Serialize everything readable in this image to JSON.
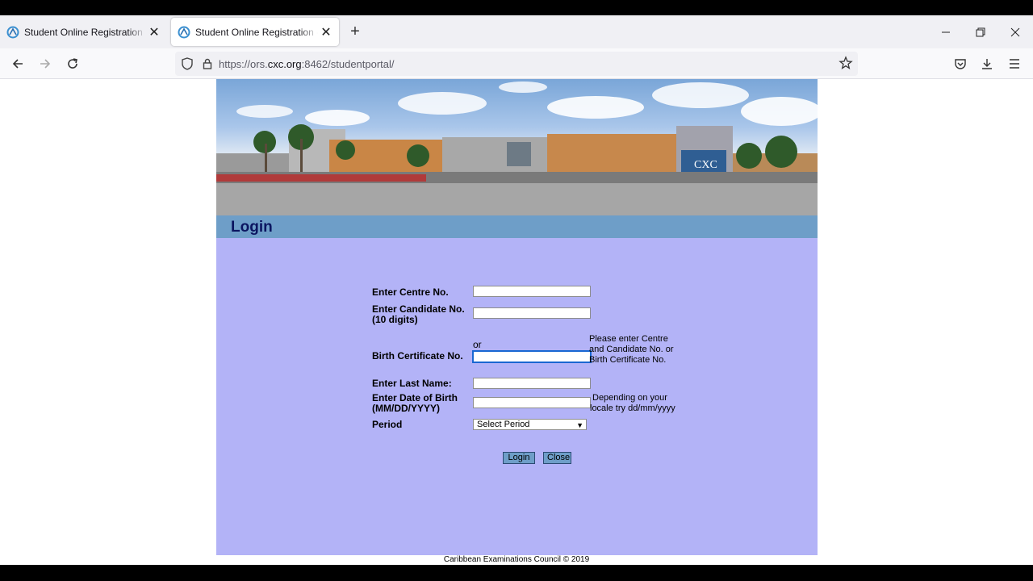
{
  "browser": {
    "tabs": [
      {
        "title": "Student Online Registration - Lo",
        "active": false
      },
      {
        "title": "Student Online Registration - Lo",
        "active": true
      }
    ],
    "url_prefix": "https://ors.",
    "url_domain": "cxc.org",
    "url_suffix": ":8462/studentportal/"
  },
  "page": {
    "heading": "Login",
    "labels": {
      "centre": "Enter Centre No.",
      "candidate_line1": "Enter Candidate No.",
      "candidate_line2": "(10 digits)",
      "or": "or",
      "birth_cert": "Birth Certificate No.",
      "last_name": "Enter Last Name:",
      "dob_line1": "Enter Date of Birth",
      "dob_line2": "(MM/DD/YYYY)",
      "period": "Period"
    },
    "notes": {
      "ids_line1": "Please enter Centre",
      "ids_line2": "and Candidate No. or",
      "ids_line3": "Birth Certificate No.",
      "dob_line1": "Depending on your",
      "dob_line2": "locale try dd/mm/yyyy"
    },
    "period_select": {
      "selected": "Select Period"
    },
    "buttons": {
      "login": "Login",
      "close": "Close"
    },
    "footer": "Caribbean Examinations Council © 2019"
  },
  "colors": {
    "form_background": "#b3b3f7",
    "header_bar": "#6e9ec8",
    "heading_text": "#0b1560"
  }
}
